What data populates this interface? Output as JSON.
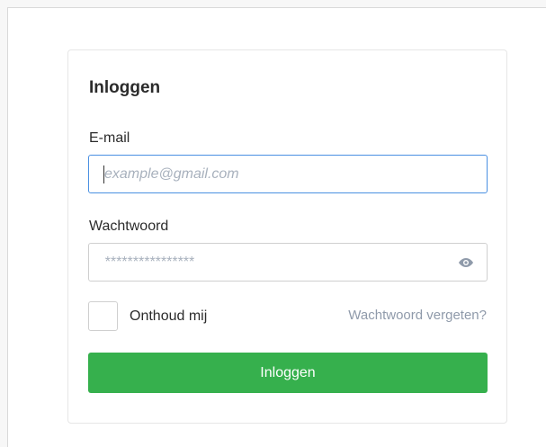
{
  "login_form": {
    "title": "Inloggen",
    "email": {
      "label": "E-mail",
      "value": "",
      "placeholder": "example@gmail.com"
    },
    "password": {
      "label": "Wachtwoord",
      "value": "",
      "placeholder": "****************",
      "toggle_icon": "eye-icon"
    },
    "remember_me": {
      "label": "Onthoud mij",
      "checked": false
    },
    "forgot_password_link": "Wachtwoord vergeten?",
    "submit_label": "Inloggen"
  },
  "colors": {
    "primary_button": "#36b04d",
    "focus_border": "#4a90e2",
    "link": "#8f9aaa"
  }
}
